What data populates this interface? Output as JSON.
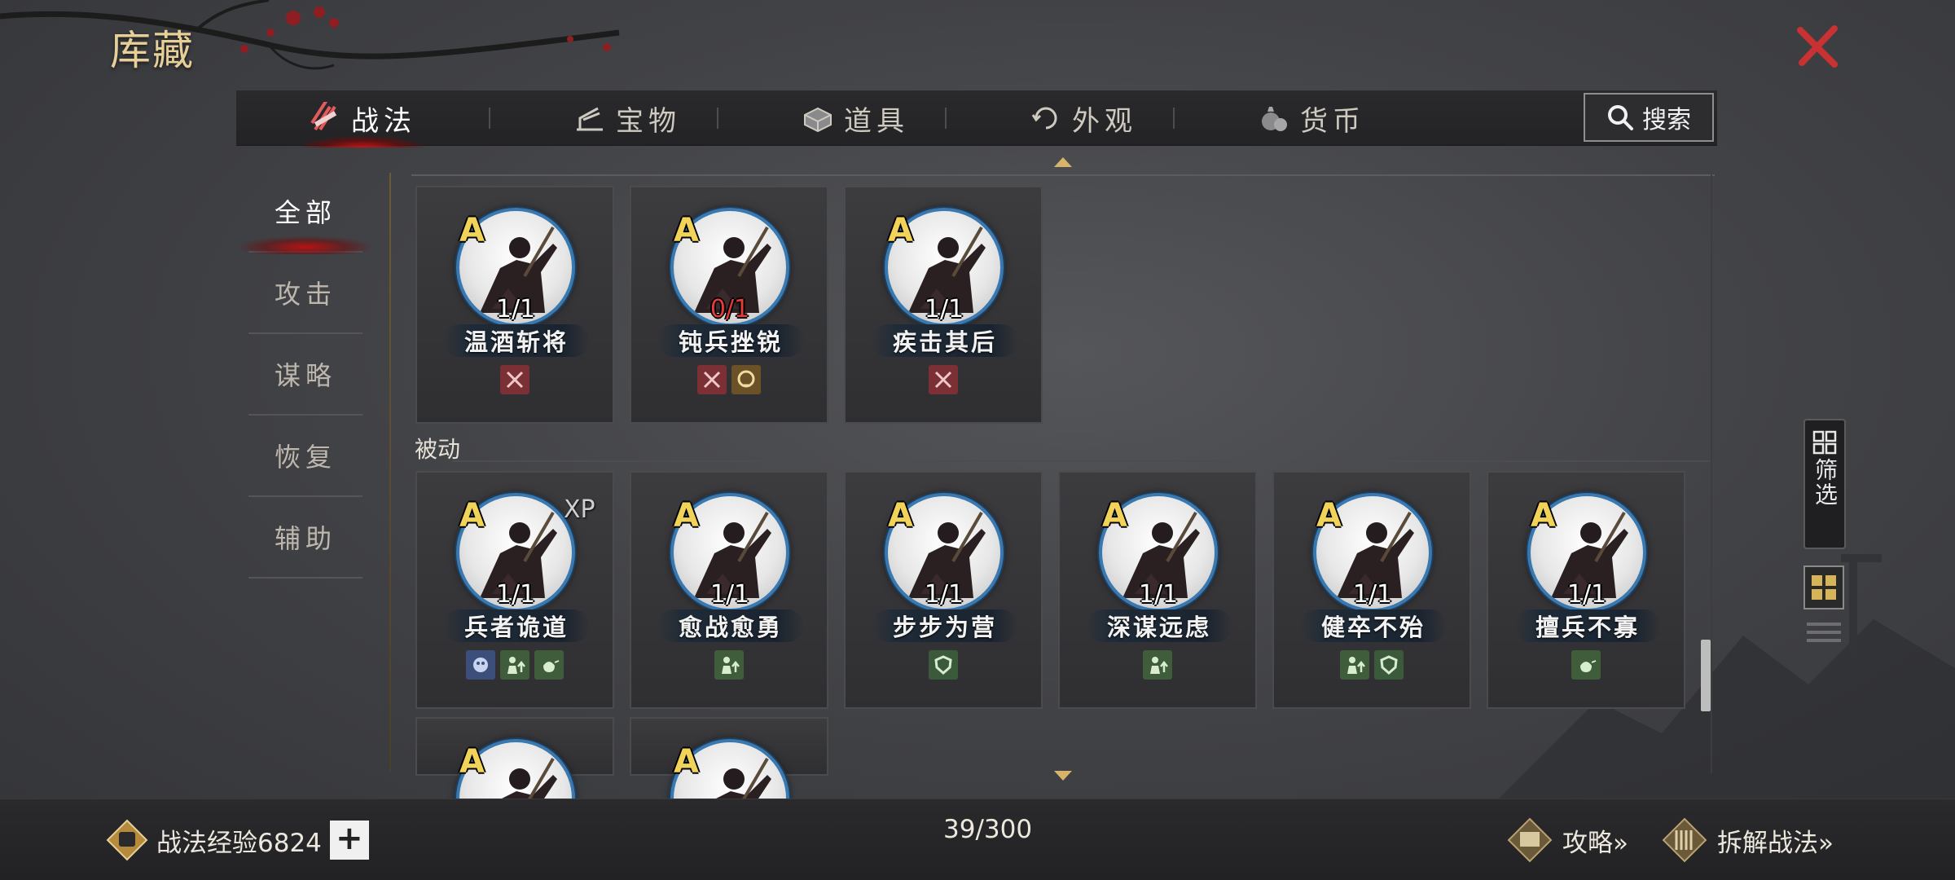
{
  "page": {
    "title": "库藏"
  },
  "tabs": [
    {
      "label": "战法",
      "icon": "scroll-icon",
      "active": true
    },
    {
      "label": "宝物",
      "icon": "treasure-icon",
      "active": false
    },
    {
      "label": "道具",
      "icon": "item-box-icon",
      "active": false
    },
    {
      "label": "外观",
      "icon": "appearance-icon",
      "active": false
    },
    {
      "label": "货币",
      "icon": "currency-bag-icon",
      "active": false
    }
  ],
  "search": {
    "label": "搜索"
  },
  "categories": [
    {
      "label": "全部",
      "active": true
    },
    {
      "label": "攻击",
      "active": false
    },
    {
      "label": "谋略",
      "active": false
    },
    {
      "label": "恢复",
      "active": false
    },
    {
      "label": "辅助",
      "active": false
    }
  ],
  "sections": {
    "passive_label": "被动"
  },
  "cards_top": [
    {
      "grade": "A",
      "count": "1/1",
      "name": "温酒斩将",
      "tags": [
        "attack"
      ]
    },
    {
      "grade": "A",
      "count": "0/1",
      "name": "钝兵挫锐",
      "tags": [
        "attack",
        "debuff"
      ]
    },
    {
      "grade": "A",
      "count": "1/1",
      "name": "疾击其后",
      "tags": [
        "attack"
      ]
    }
  ],
  "cards_passive": [
    {
      "grade": "A",
      "count": "1/1",
      "name": "兵者诡道",
      "xp": "XP",
      "tags": [
        "magic",
        "buff",
        "heal"
      ]
    },
    {
      "grade": "A",
      "count": "1/1",
      "name": "愈战愈勇",
      "tags": [
        "buff"
      ]
    },
    {
      "grade": "A",
      "count": "1/1",
      "name": "步步为营",
      "tags": [
        "shield"
      ]
    },
    {
      "grade": "A",
      "count": "1/1",
      "name": "深谋远虑",
      "tags": [
        "buff"
      ]
    },
    {
      "grade": "A",
      "count": "1/1",
      "name": "健卒不殆",
      "tags": [
        "buff",
        "shield"
      ]
    },
    {
      "grade": "A",
      "count": "1/1",
      "name": "擅兵不寡",
      "tags": [
        "heal"
      ]
    }
  ],
  "cards_partial": [
    {
      "grade": "A"
    },
    {
      "grade": "A"
    }
  ],
  "filter": {
    "label": "筛选"
  },
  "bottom": {
    "exp_label": "战法经验6824",
    "plus": "+",
    "capacity": "39/300",
    "guide_label": "攻略»",
    "disassemble_label": "拆解战法»"
  },
  "colors": {
    "accent_gold": "#e7cf98",
    "grade_yellow": "#f2d35a",
    "active_red": "#c81414",
    "portrait_ring": "#3a78b0",
    "zero_count_red": "#e73a3a"
  }
}
